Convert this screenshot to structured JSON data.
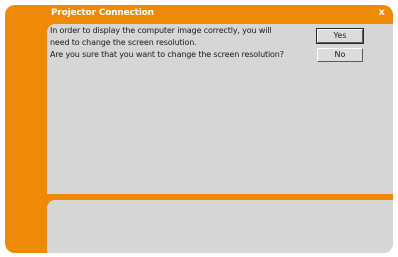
{
  "dialog": {
    "title": "Projector Connection",
    "close_glyph": "x",
    "message_lines": [
      "In order to display the computer image correctly, you will",
      "need to change the screen resolution.",
      "Are you sure that you want to change the screen resolution?"
    ],
    "buttons": {
      "yes_label": "Yes",
      "no_label": "No"
    }
  },
  "colors": {
    "frame_orange": "#ee8a06",
    "panel_gray": "#d6d6d6"
  }
}
